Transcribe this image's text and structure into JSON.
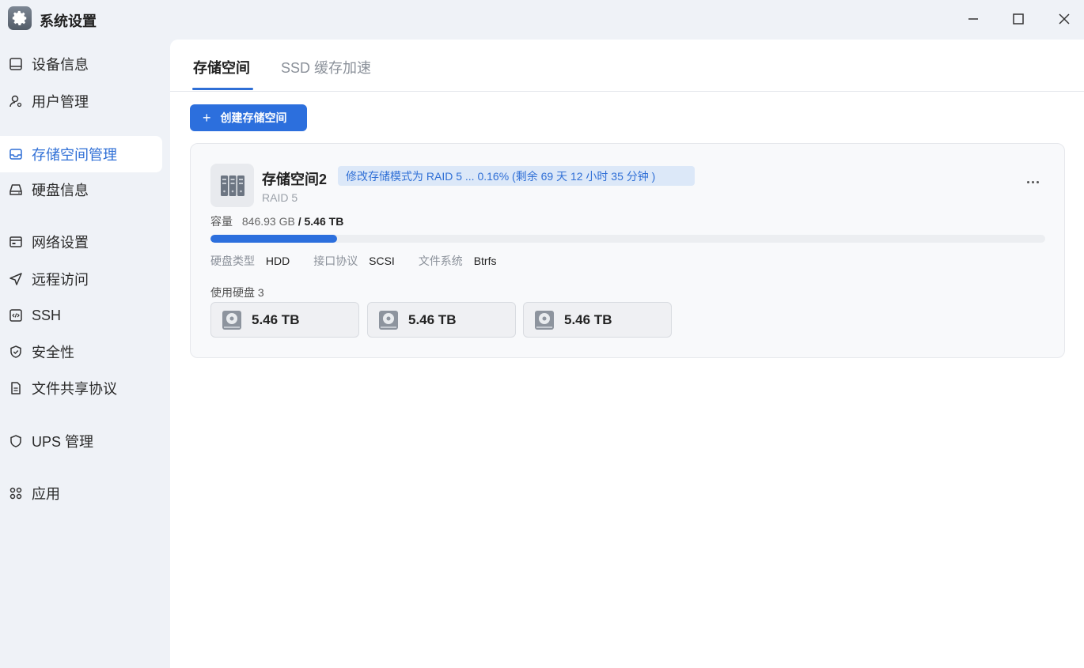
{
  "window": {
    "title": "系统设置",
    "icon": "gear-icon",
    "controls": [
      "minimize-icon",
      "maximize-icon",
      "close-icon"
    ]
  },
  "sidebar": {
    "items": [
      {
        "label": "设备信息",
        "icon": "device-icon"
      },
      {
        "label": "用户管理",
        "icon": "user-icon"
      },
      {
        "label": "存储空间管理",
        "icon": "storage-icon",
        "active": true
      },
      {
        "label": "硬盘信息",
        "icon": "disk-icon"
      },
      {
        "label": "网络设置",
        "icon": "network-icon"
      },
      {
        "label": "远程访问",
        "icon": "send-icon"
      },
      {
        "label": "SSH",
        "icon": "code-icon"
      },
      {
        "label": "安全性",
        "icon": "shield-check-icon"
      },
      {
        "label": "文件共享协议",
        "icon": "file-icon"
      },
      {
        "label": "UPS 管理",
        "icon": "shield-icon"
      },
      {
        "label": "应用",
        "icon": "apps-icon"
      }
    ]
  },
  "tabs": [
    {
      "label": "存储空间",
      "active": true
    },
    {
      "label": "SSD 缓存加速",
      "active": false
    }
  ],
  "toolbar": {
    "create_label": "创建存储空间",
    "create_icon": "plus-icon"
  },
  "pool": {
    "name": "存储空间2",
    "badge": "修改存储模式为 RAID 5 ... 0.16%   (剩余 69 天 12 小时 35 分钟 )",
    "raid": "RAID 5",
    "capacity_label": "容量",
    "capacity_used": "846.93 GB",
    "capacity_sep": "/",
    "capacity_total": "5.46 TB",
    "usage_fraction": 0.152,
    "meta": [
      {
        "key": "硬盘类型",
        "value": "HDD"
      },
      {
        "key": "接口协议",
        "value": "SCSI"
      },
      {
        "key": "文件系统",
        "value": "Btrfs"
      }
    ],
    "disks_label": "使用硬盘 3",
    "disks": [
      {
        "size": "5.46 TB"
      },
      {
        "size": "5.46 TB"
      },
      {
        "size": "5.46 TB"
      }
    ]
  },
  "colors": {
    "accent": "#2c6fdd",
    "sidebar_bg": "#eff2f7",
    "badge_bg": "#dce8f8"
  }
}
